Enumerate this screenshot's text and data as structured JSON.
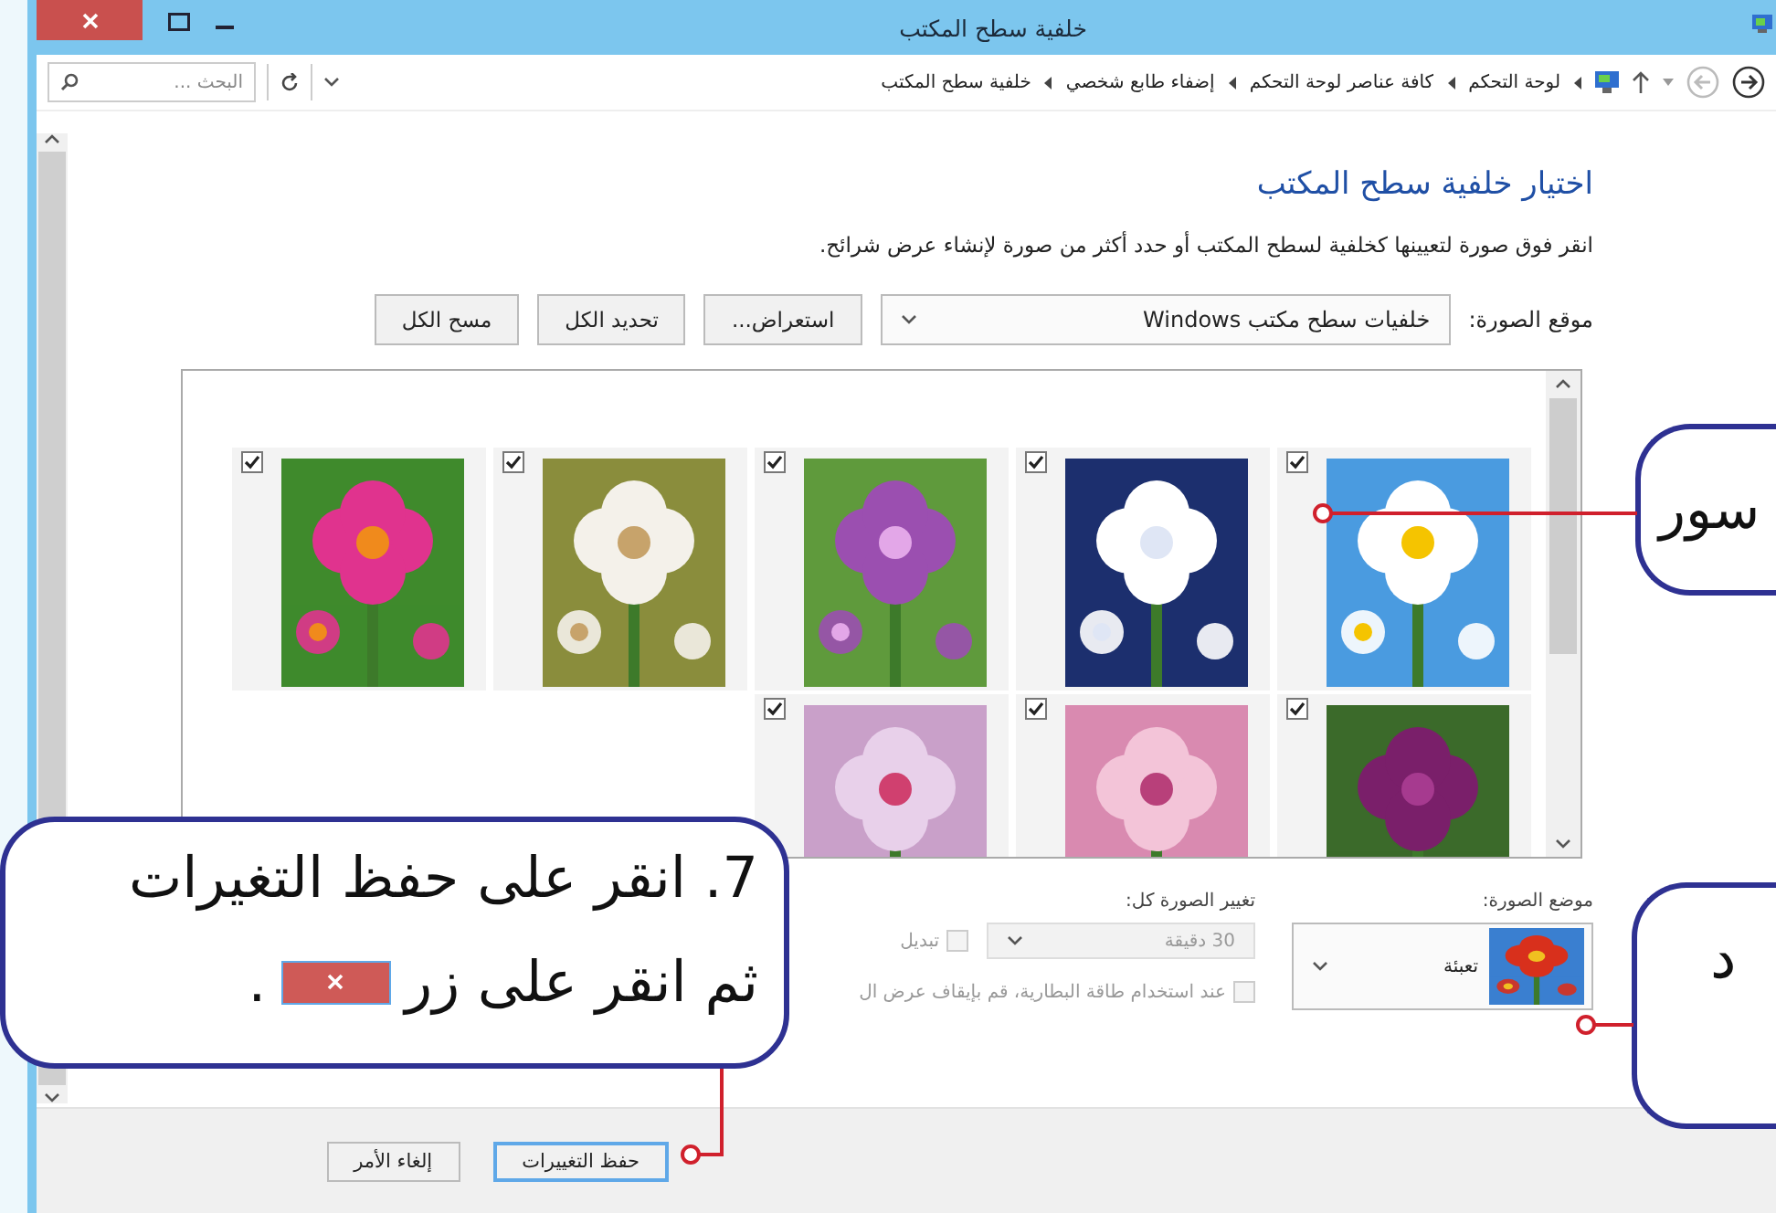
{
  "window": {
    "title": "خلفية سطح المكتب"
  },
  "address_bar": {
    "breadcrumbs": [
      "لوحة التحكم",
      "كافة عناصر لوحة التحكم",
      "إضفاء طابع شخصي",
      "خلفية سطح المكتب"
    ],
    "search": {
      "placeholder": "البحث ..."
    }
  },
  "heading": "اختيار خلفية سطح المكتب",
  "description": "انقر فوق صورة لتعيينها كخلفية لسطح المكتب أو حدد أكثر من صورة لإنشاء عرض شرائح.",
  "picture_location": {
    "label": "موقع الصورة:",
    "value": "خلفيات سطح مكتب Windows"
  },
  "buttons": [
    "استعراض...",
    "تحديد الكل",
    "مسح الكل"
  ],
  "thumbnails": [
    {
      "checked": true
    },
    {
      "checked": true
    },
    {
      "checked": true
    },
    {
      "checked": true
    },
    {
      "checked": true
    },
    {
      "checked": true
    },
    {
      "checked": true
    },
    {
      "checked": true
    }
  ],
  "picture_position": {
    "label": "موضع الصورة:",
    "value": "تعبئة"
  },
  "change_picture": {
    "label": "تغيير الصورة كل:",
    "value": "30 دقيقة",
    "disabled": true
  },
  "shuffle": {
    "label": "تبديل",
    "checked": false,
    "disabled": true
  },
  "battery": {
    "label": "عند استخدام طاقة البطارية، قم بإيقاف عرض ال",
    "checked": false,
    "disabled": true
  },
  "footer_buttons": [
    {
      "label": "حفظ التغييرات",
      "default": true
    },
    {
      "label": "إلغاء الأمر",
      "default": false
    }
  ],
  "callouts": [
    {
      "kind": "text",
      "text": "سور"
    },
    {
      "kind": "text",
      "text": "د"
    },
    {
      "kind": "step",
      "lines": [
        "7. انقر على حفظ التغيرات",
        "ثم انقر على زر"
      ],
      "end": "."
    }
  ]
}
